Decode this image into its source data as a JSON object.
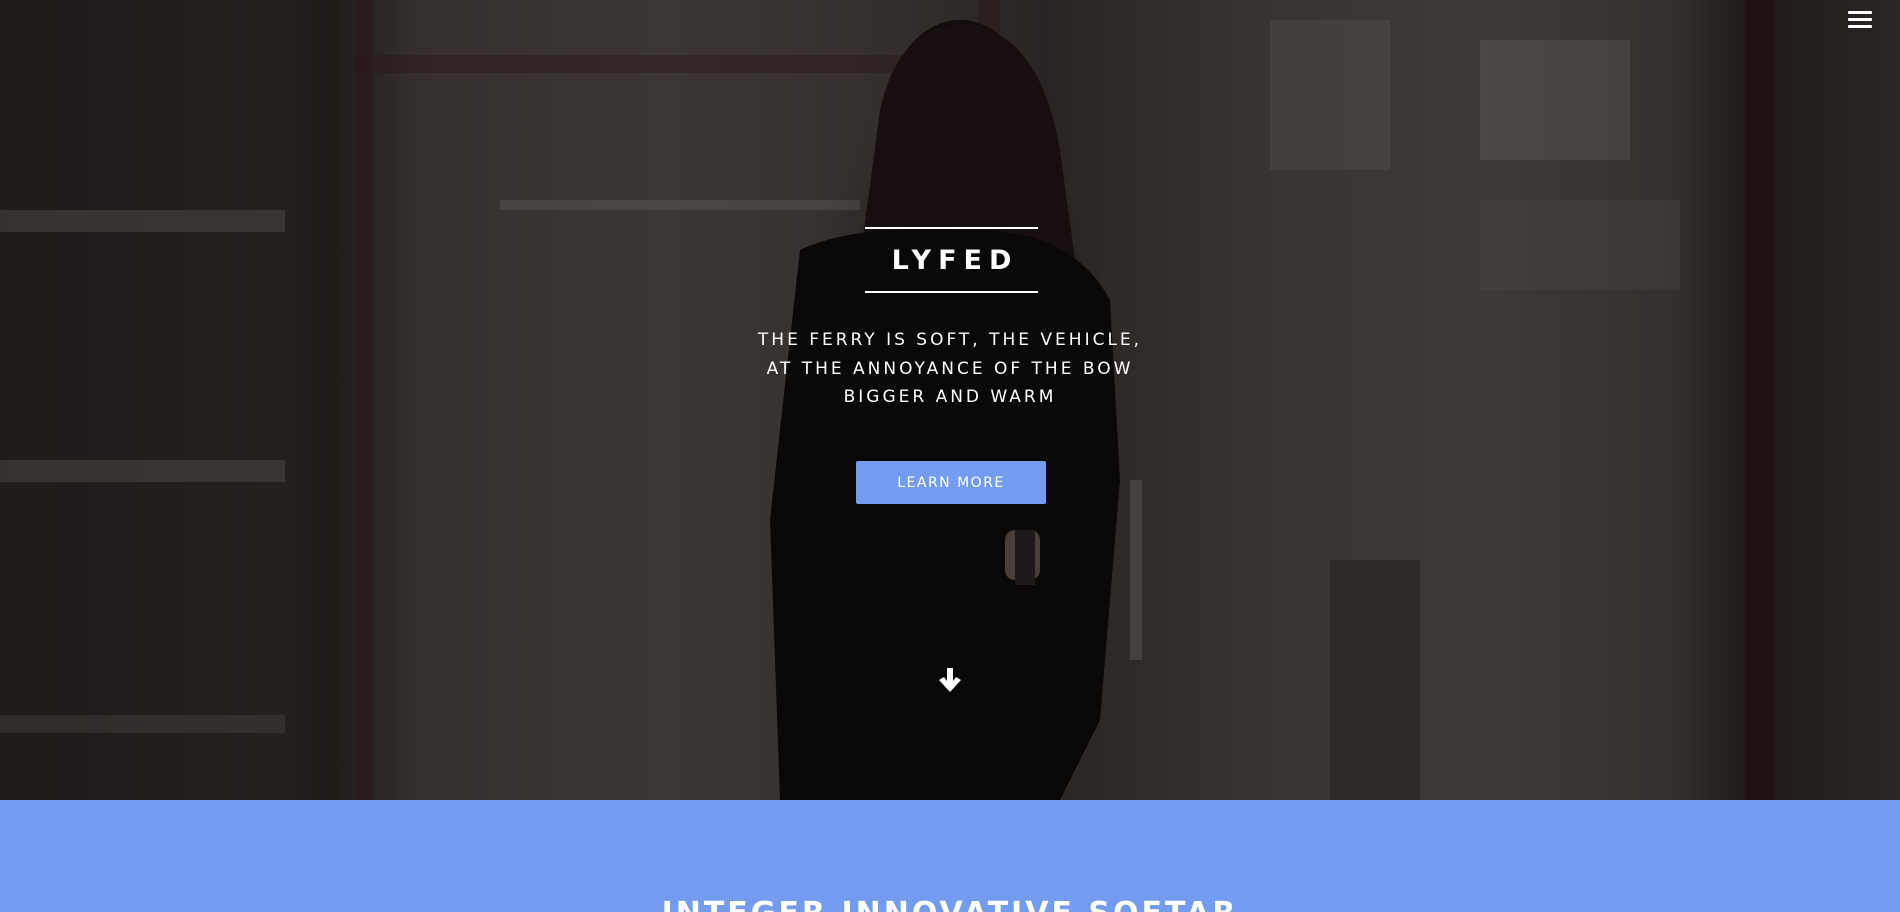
{
  "hero": {
    "brand": "LYFED",
    "tagline_lines": [
      "THE FERRY IS SOFT, THE VEHICLE,",
      "AT THE ANNOYANCE OF THE BOW",
      "BIGGER AND WARM"
    ],
    "cta_label": "LEARN MORE",
    "menu_icon": "hamburger-menu-icon",
    "scroll_icon": "arrow-down-icon"
  },
  "section": {
    "title": "INTEGER INNOVATIVE SOFTAR"
  },
  "colors": {
    "accent": "#739cf0",
    "text": "#ffffff"
  }
}
